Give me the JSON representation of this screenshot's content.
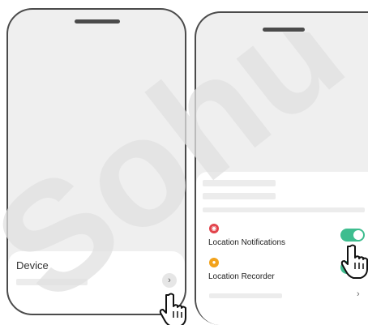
{
  "left_screen": {
    "sheet_title": "Device",
    "chevron_glyph": "›"
  },
  "right_screen": {
    "settings": [
      {
        "label": "Location Notifications",
        "icon": "bell-icon",
        "icon_color": "#e2434b",
        "toggle_on": true
      },
      {
        "label": "Location Recorder",
        "icon": "location-pin-icon",
        "icon_color": "#f2a21b",
        "toggle_on": true
      }
    ],
    "chevron_glyph": "›"
  },
  "colors": {
    "toggle_on": "#3ebd8f",
    "watermark": "#e0e0e0",
    "frame": "#4b4b4b"
  },
  "watermark_text": "Sohu"
}
